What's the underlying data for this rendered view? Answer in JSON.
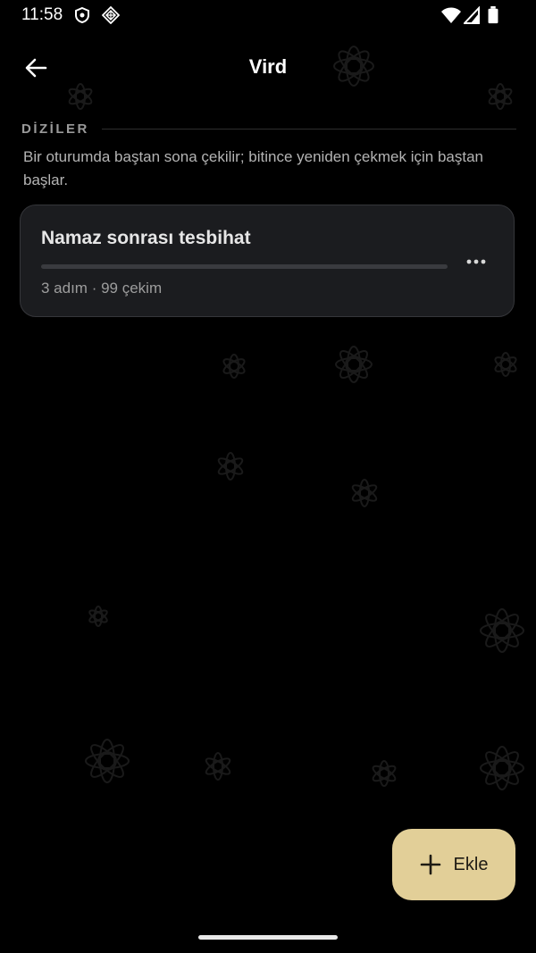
{
  "status_bar": {
    "time": "11:58",
    "left_icons": [
      "shield-icon",
      "android-auto-icon"
    ],
    "right_icons": [
      "wifi-icon",
      "signal-icon",
      "battery-icon"
    ]
  },
  "app_bar": {
    "back_icon": "arrow-left-icon",
    "title": "Vird"
  },
  "sections": [
    {
      "title": "DİZİLER",
      "description": "Bir oturumda baştan sona çekilir; bitince yeniden çekmek için baştan başlar.",
      "items": [
        {
          "title": "Namaz sonrası tesbihat",
          "meta": "3 adım · 99 çekim",
          "progress": 0,
          "menu_icon": "more-horizontal-icon"
        }
      ]
    }
  ],
  "fab": {
    "icon": "plus-icon",
    "label": "Ekle"
  },
  "colors": {
    "background": "#000000",
    "card": "#1b1c1f",
    "accent": "#e2cf98",
    "muted_text": "#9d9d9d"
  }
}
